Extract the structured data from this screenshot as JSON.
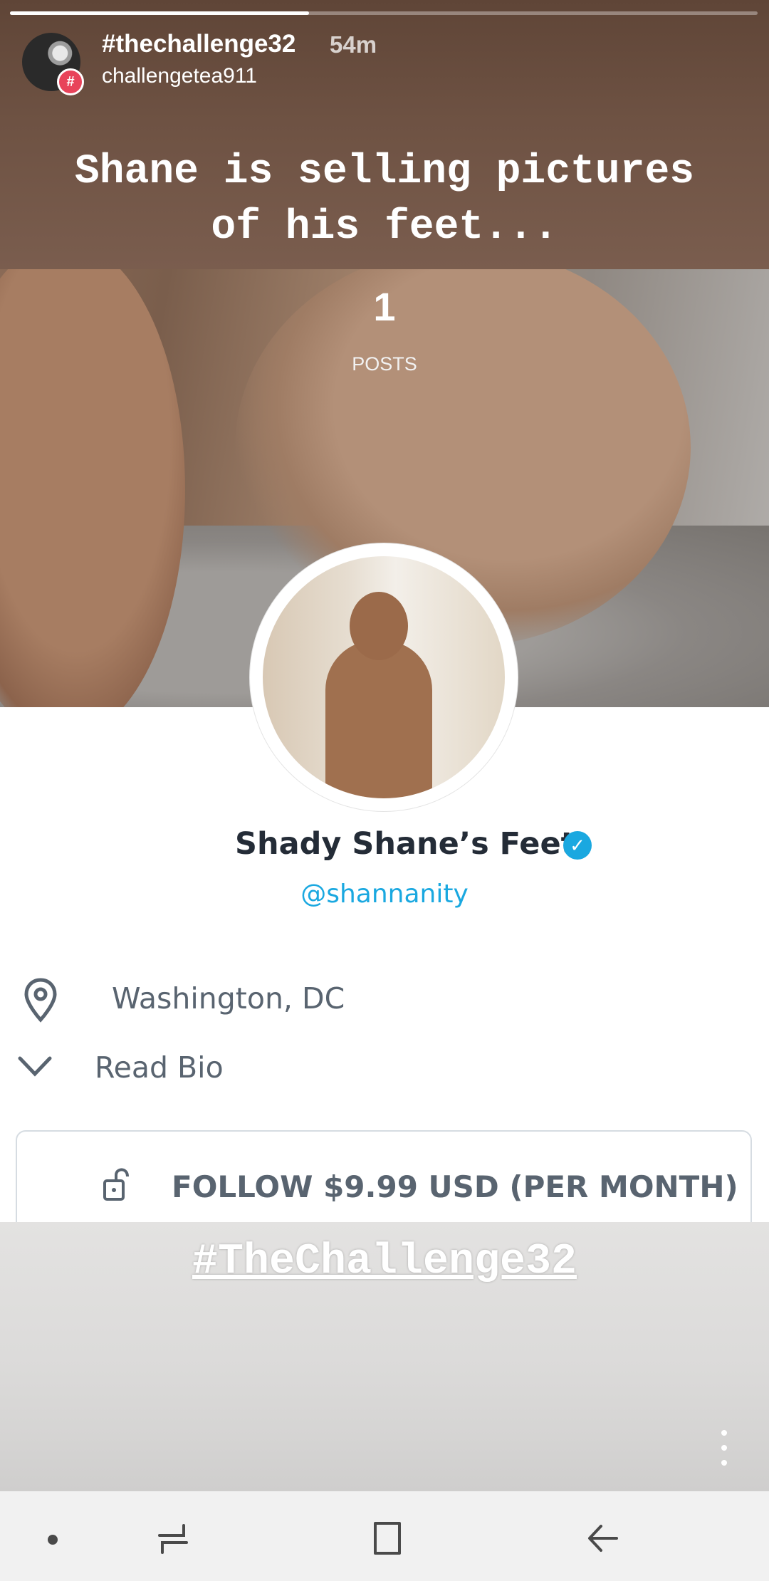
{
  "story": {
    "title": "#thechallenge32",
    "time": "54m",
    "username": "challengetea911",
    "badge": "#",
    "progress": 0.4,
    "caption_line1": "Shane is selling pictures",
    "caption_line2": "of his feet...",
    "hashtag": "#TheChallenge32"
  },
  "profile": {
    "posts_count": "1",
    "posts_label": "POSTS",
    "name": "Shady Shane’s Feet",
    "verified_mark": "✓",
    "handle": "@shannanity",
    "location": "Washington, DC",
    "read_bio": "Read Bio",
    "follow_label": "FOLLOW $9.99 USD (PER MONTH)"
  },
  "icons": {
    "location": "location-pin-icon",
    "bio": "chevron-down-icon",
    "follow": "unlock-icon",
    "menu": "more-vertical-icon",
    "nav": [
      "dot-icon",
      "recent-apps-icon",
      "home-icon",
      "back-icon"
    ]
  },
  "colors": {
    "accent": "#1aa8e0",
    "name": "#242c37",
    "secondary_text": "#596470",
    "badge": "#e8435a"
  }
}
